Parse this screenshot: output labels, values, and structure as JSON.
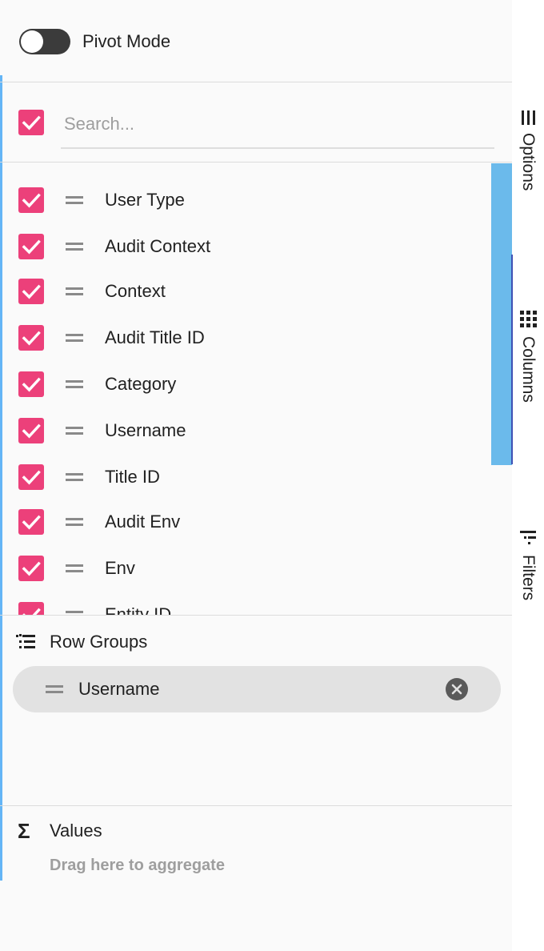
{
  "pivot": {
    "label": "Pivot Mode",
    "enabled": false
  },
  "search": {
    "placeholder": "Search..."
  },
  "columns": [
    {
      "label": "User Type",
      "checked": true
    },
    {
      "label": "Audit Context",
      "checked": true
    },
    {
      "label": "Context",
      "checked": true
    },
    {
      "label": "Audit Title ID",
      "checked": true
    },
    {
      "label": "Category",
      "checked": true
    },
    {
      "label": "Username",
      "checked": true
    },
    {
      "label": "Title ID",
      "checked": true
    },
    {
      "label": "Audit Env",
      "checked": true
    },
    {
      "label": "Env",
      "checked": true
    },
    {
      "label": "Entity ID",
      "checked": true
    }
  ],
  "row_groups": {
    "title": "Row Groups",
    "chips": [
      {
        "label": "Username"
      }
    ]
  },
  "values": {
    "title": "Values",
    "hint": "Drag here to aggregate"
  },
  "side_tabs": [
    {
      "label": "Options",
      "icon": "hamburger-icon",
      "active": false
    },
    {
      "label": "Columns",
      "icon": "grid-icon",
      "active": true
    },
    {
      "label": "Filters",
      "icon": "filter-icon",
      "active": false
    }
  ],
  "colors": {
    "checkbox": "#ec407a",
    "scrollbar": "#6bbaeb",
    "active_tab": "#3f51b5"
  }
}
